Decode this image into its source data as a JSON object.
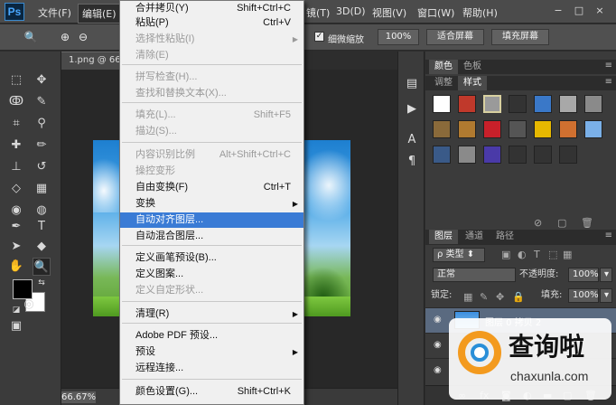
{
  "app": {
    "logo": "Ps"
  },
  "menubar": {
    "items": [
      "文件(F)",
      "编辑(E)",
      "镜(T)",
      "3D(D)",
      "视图(V)",
      "窗口(W)",
      "帮助(H)"
    ],
    "window_buttons": [
      "−",
      "□",
      "×"
    ]
  },
  "options_bar": {
    "tool_icon": "zoom-icon",
    "scrubby_zoom_label": "细微缩放",
    "scrubby_zoom_checked": true,
    "btn_100": "100%",
    "btn_fit": "适合屏幕",
    "btn_fill": "填充屏幕"
  },
  "document": {
    "tab_label": "1.png @ 66.",
    "zoom": "66.67%"
  },
  "edit_menu": {
    "items": [
      {
        "label": "合并拷贝(Y)",
        "shortcut": "Shift+Ctrl+C",
        "disabled": false,
        "submenu": false
      },
      {
        "label": "粘贴(P)",
        "shortcut": "Ctrl+V",
        "disabled": false,
        "submenu": false
      },
      {
        "label": "选择性粘贴(I)",
        "shortcut": "",
        "disabled": true,
        "submenu": true
      },
      {
        "label": "清除(E)",
        "shortcut": "",
        "disabled": true,
        "submenu": false
      },
      {
        "label": "拼写检查(H)...",
        "shortcut": "",
        "disabled": true,
        "submenu": false
      },
      {
        "label": "查找和替换文本(X)...",
        "shortcut": "",
        "disabled": true,
        "submenu": false
      },
      {
        "label": "填充(L)...",
        "shortcut": "Shift+F5",
        "disabled": true,
        "submenu": false
      },
      {
        "label": "描边(S)...",
        "shortcut": "",
        "disabled": true,
        "submenu": false
      },
      {
        "label": "内容识别比例",
        "shortcut": "Alt+Shift+Ctrl+C",
        "disabled": true,
        "submenu": false
      },
      {
        "label": "操控变形",
        "shortcut": "",
        "disabled": true,
        "submenu": false
      },
      {
        "label": "自由变换(F)",
        "shortcut": "Ctrl+T",
        "disabled": false,
        "submenu": false
      },
      {
        "label": "变换",
        "shortcut": "",
        "disabled": false,
        "submenu": true
      },
      {
        "label": "自动对齐图层...",
        "shortcut": "",
        "disabled": false,
        "submenu": false,
        "highlighted": true
      },
      {
        "label": "自动混合图层...",
        "shortcut": "",
        "disabled": false,
        "submenu": false
      },
      {
        "label": "定义画笔预设(B)...",
        "shortcut": "",
        "disabled": false,
        "submenu": false
      },
      {
        "label": "定义图案...",
        "shortcut": "",
        "disabled": false,
        "submenu": false
      },
      {
        "label": "定义自定形状...",
        "shortcut": "",
        "disabled": true,
        "submenu": false
      },
      {
        "label": "清理(R)",
        "shortcut": "",
        "disabled": false,
        "submenu": true
      },
      {
        "label": "Adobe PDF 预设...",
        "shortcut": "",
        "disabled": false,
        "submenu": false
      },
      {
        "label": "预设",
        "shortcut": "",
        "disabled": false,
        "submenu": true
      },
      {
        "label": "远程连接...",
        "shortcut": "",
        "disabled": false,
        "submenu": false
      },
      {
        "label": "颜色设置(G)...",
        "shortcut": "Shift+Ctrl+K",
        "disabled": false,
        "submenu": false
      }
    ]
  },
  "color_panel": {
    "tabs": [
      "颜色",
      "色板"
    ]
  },
  "styles_panel": {
    "tabs": [
      "调整",
      "样式"
    ],
    "swatch_colors": [
      "#ffffff",
      "#c0392b",
      "#9a9a9a",
      "#333333",
      "#3a78c8",
      "#a8a8a8",
      "#8a8a8a",
      "#8a6a3a",
      "#b07a30",
      "#c8202a",
      "#555555",
      "#e6b800",
      "#d07030",
      "#7ab0e8",
      "#3a5a88",
      "#8a8a8a",
      "#4a3aa8",
      "#333333",
      "#333333",
      "#333333"
    ]
  },
  "layers_panel": {
    "tabs": [
      "图层",
      "通道",
      "路径"
    ],
    "filter_label": "类型",
    "blend_mode": "正常",
    "opacity_label": "不透明度:",
    "opacity_value": "100%",
    "lock_label": "锁定:",
    "fill_label": "填充:",
    "fill_value": "100%",
    "layers": [
      {
        "name": "图层 0 拷贝 2"
      },
      {
        "name": ""
      },
      {
        "name": ""
      }
    ]
  },
  "watermark": {
    "title": "查询啦",
    "url": "chaxunla.com"
  }
}
